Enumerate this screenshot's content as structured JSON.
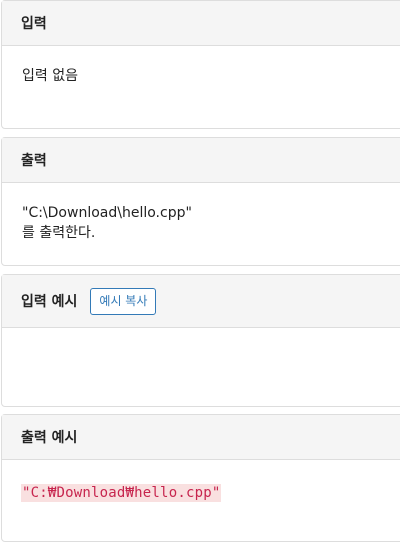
{
  "sections": {
    "input": {
      "title": "입력",
      "body": "입력 없음"
    },
    "output": {
      "title": "출력",
      "line1": "\"C:\\Download\\hello.cpp\"",
      "line2": "를 출력한다."
    },
    "sample_input": {
      "title": "입력 예시",
      "copy_button_label": "예시 복사",
      "body": ""
    },
    "sample_output": {
      "title": "출력 예시",
      "body": "\"C:₩Download₩hello.cpp\""
    }
  },
  "colors": {
    "panel_header_bg": "#f5f5f5",
    "border": "#dddddd",
    "button_accent": "#337ab7",
    "code_bg": "#f9e0e0",
    "code_text": "#c7254e"
  }
}
